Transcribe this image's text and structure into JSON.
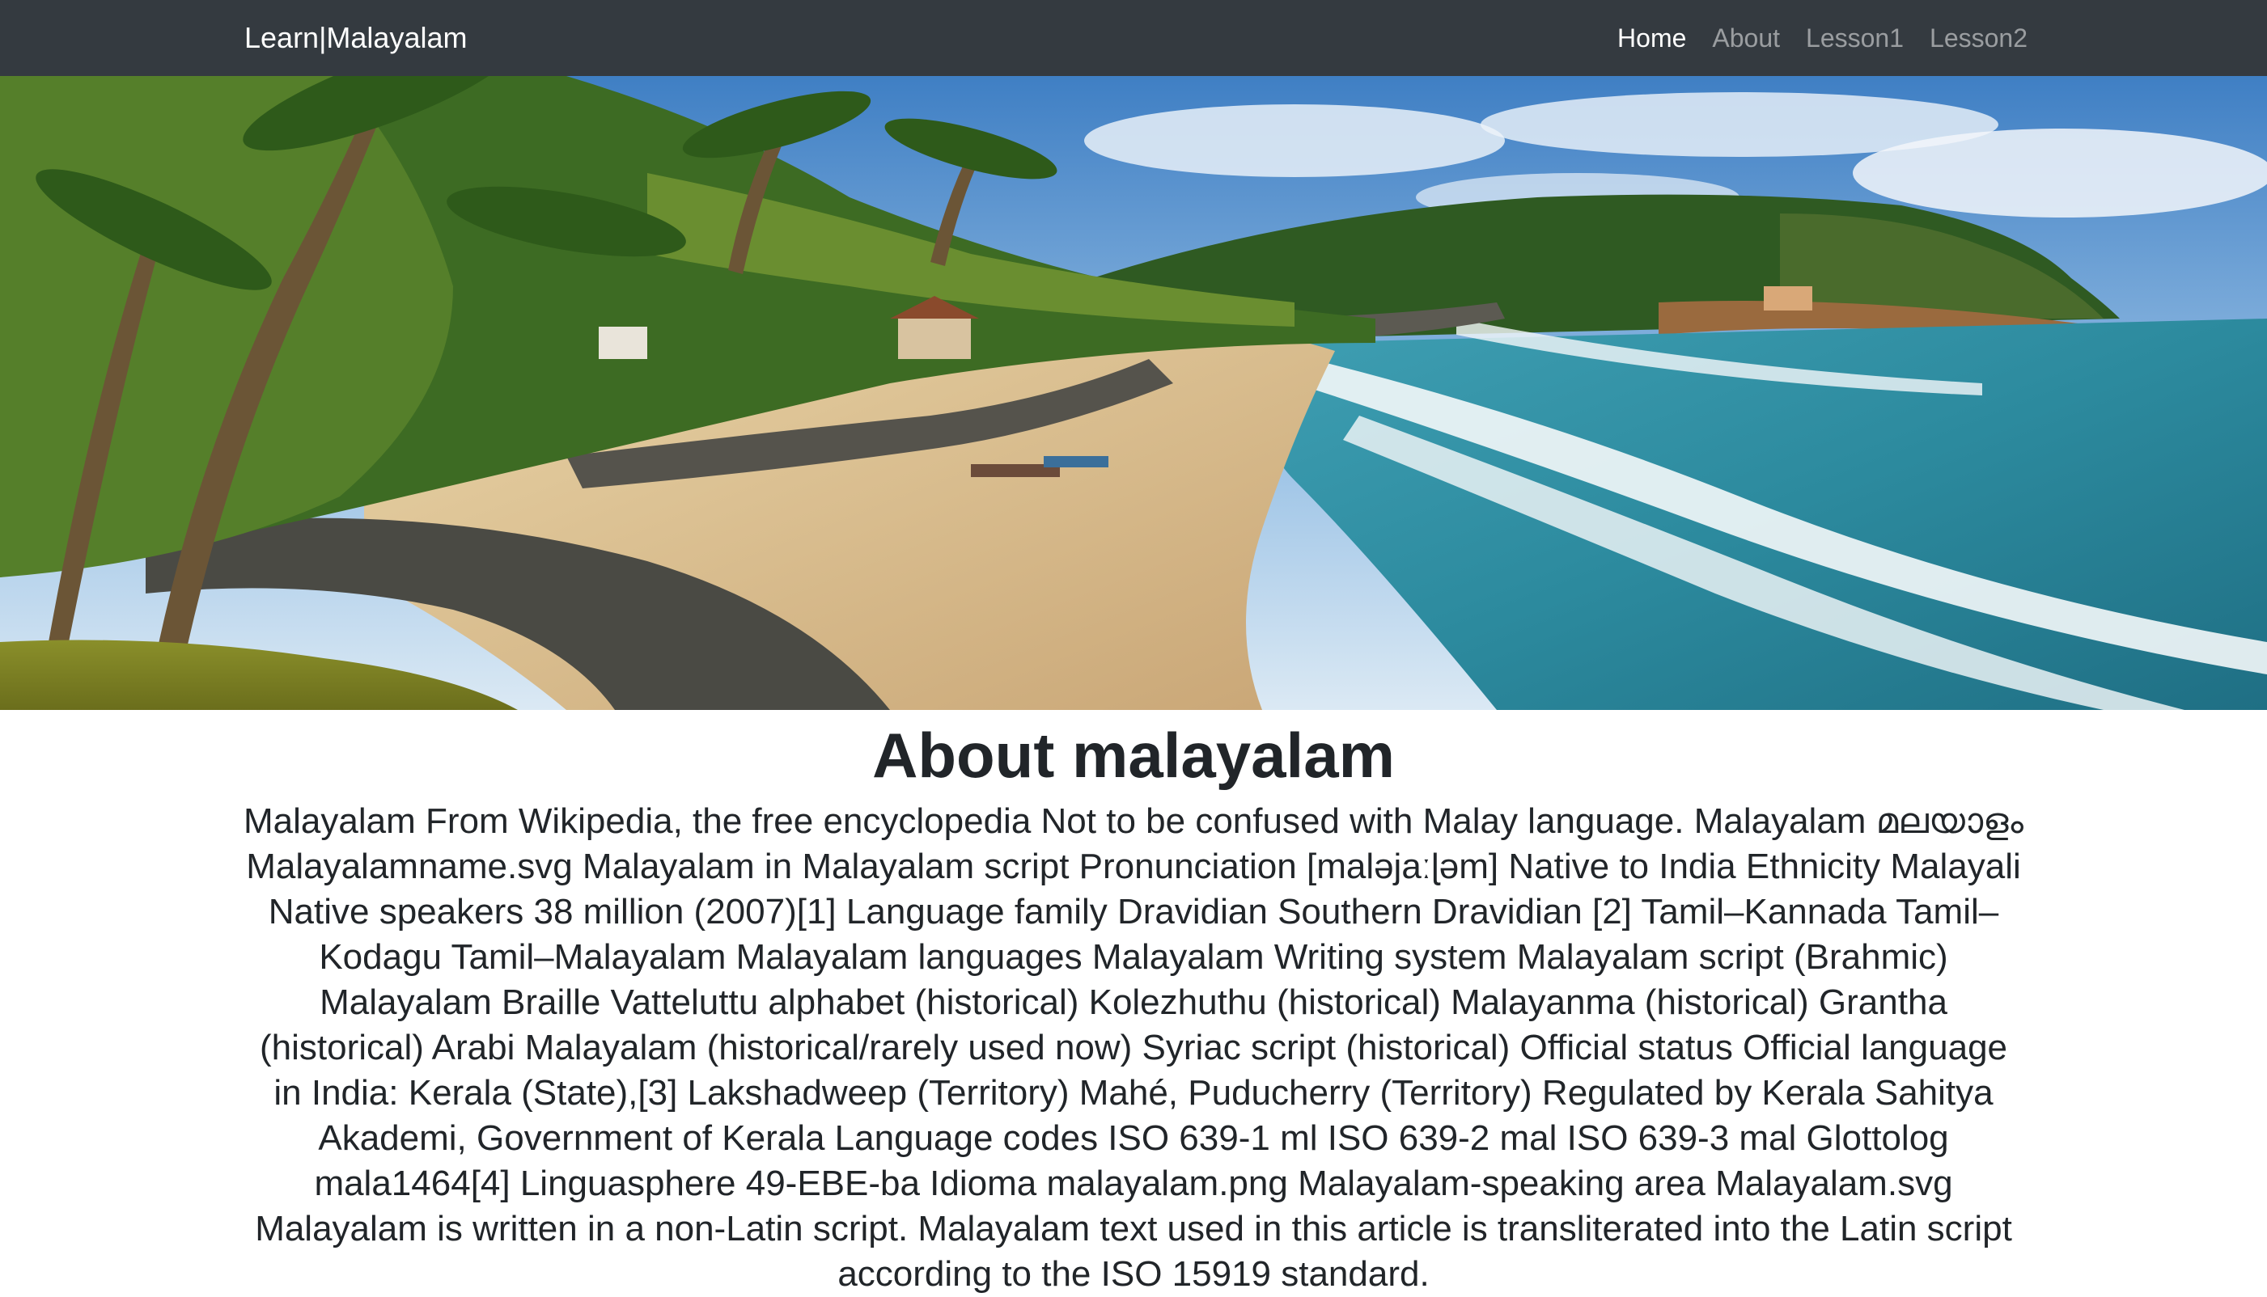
{
  "navbar": {
    "brand": "Learn|Malayalam",
    "links": [
      {
        "label": "Home",
        "active": true
      },
      {
        "label": "About",
        "active": false
      },
      {
        "label": "Lesson1",
        "active": false
      },
      {
        "label": "Lesson2",
        "active": false
      }
    ]
  },
  "hero": {
    "image": "kerala-beach-photo"
  },
  "main": {
    "title": "About malayalam",
    "body": "Malayalam From Wikipedia, the free encyclopedia Not to be confused with Malay language. Malayalam മലയാളം Malayalamname.svg Malayalam in Malayalam script Pronunciation [maləjaːɭəm] Native to India Ethnicity Malayali Native speakers 38 million (2007)[1] Language family Dravidian Southern Dravidian [2] Tamil–Kannada Tamil–Kodagu Tamil–Malayalam Malayalam languages Malayalam Writing system Malayalam script (Brahmic) Malayalam Braille Vatteluttu alphabet (historical) Kolezhuthu (historical) Malayanma (historical) Grantha (historical) Arabi Malayalam (historical/rarely used now) Syriac script (historical) Official status Official language in India: Kerala (State),[3] Lakshadweep (Territory) Mahé, Puducherry (Territory) Regulated by Kerala Sahitya Akademi, Government of Kerala Language codes ISO 639-1 ml ISO 639-2 mal ISO 639-3 mal Glottolog mala1464[4] Linguasphere 49-EBE-ba Idioma malayalam.png Malayalam-speaking area Malayalam.svg Malayalam is written in a non-Latin script. Malayalam text used in this article is transliterated into the Latin script according to the ISO 15919 standard."
  },
  "colors": {
    "navbar_bg": "#343a40",
    "nav_active": "#ffffff",
    "nav_inactive": "#9a9da0",
    "text": "#212529"
  }
}
